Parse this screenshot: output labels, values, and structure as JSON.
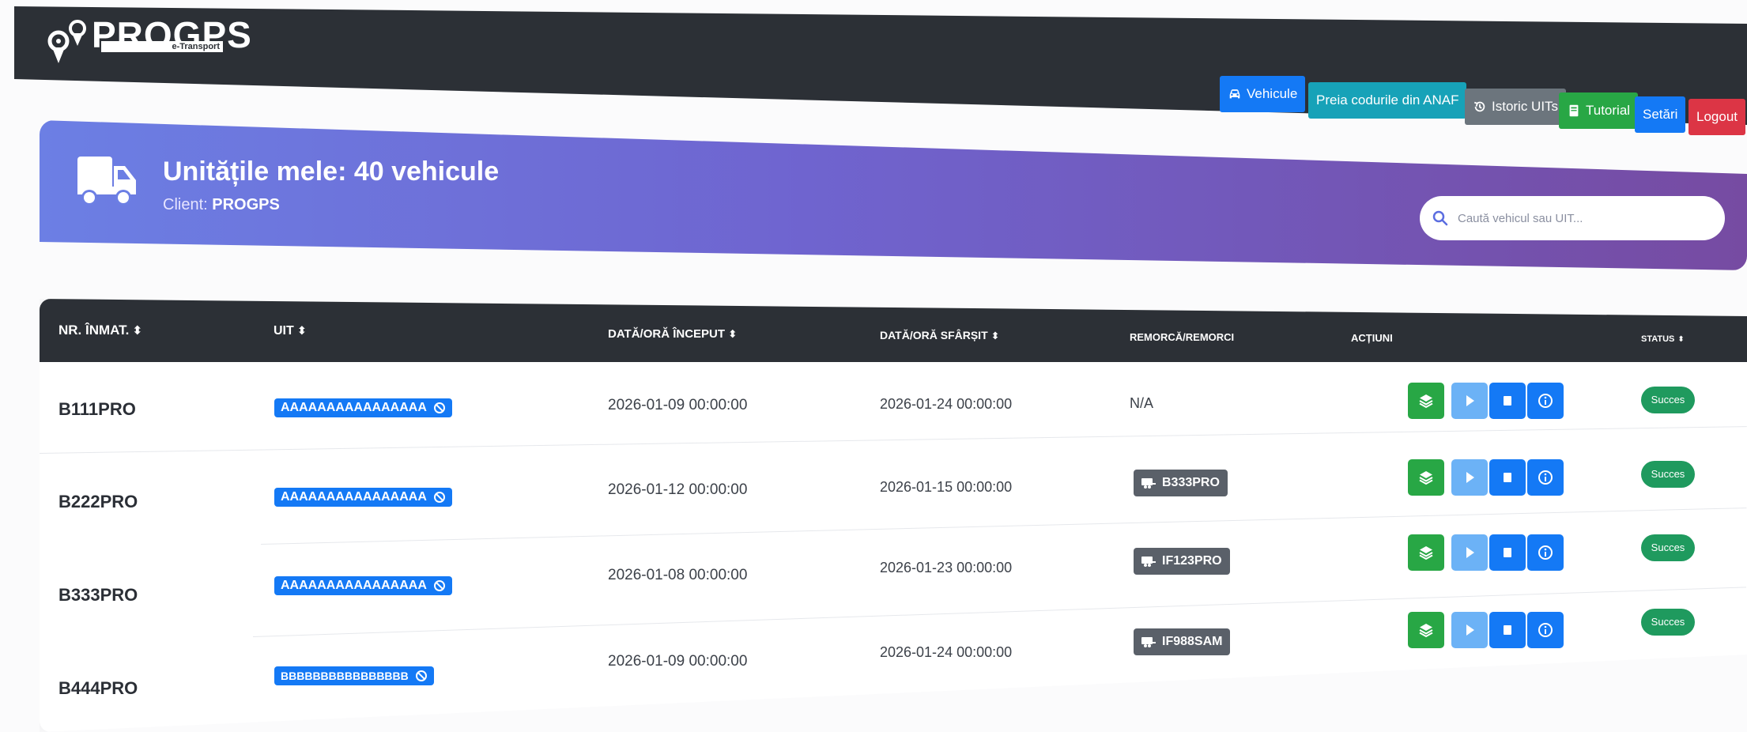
{
  "brand": {
    "name": "PROGPS",
    "tagline": "e-Transport"
  },
  "nav": {
    "vehicles": "Vehicule",
    "fetch_anaf": "Preia codurile din ANAF",
    "uit_history": "Istoric UITs",
    "tutorial": "Tutorial",
    "settings": "Setări",
    "logout": "Logout"
  },
  "banner": {
    "title": "Unitățile mele: 40 vehicule",
    "client_label": "Client:",
    "client_name": "PROGPS"
  },
  "search": {
    "placeholder": "Caută vehicul sau UIT..."
  },
  "table": {
    "headers": {
      "plate": "NR. ÎNMAT.",
      "uit": "UIT",
      "start": "DATĂ/ORĂ ÎNCEPUT",
      "end": "DATĂ/ORĂ SFÂRȘIT",
      "trailer": "REMORCĂ/REMORCI",
      "actions": "ACȚIUNI",
      "status": "STATUS"
    },
    "sort_glyph": "⬍",
    "rows": [
      {
        "plate": "B111PRO",
        "uit": "AAAAAAAAAAAAAAAA",
        "start": "2026-01-09 00:00:00",
        "end": "2026-01-24 00:00:00",
        "trailer": "N/A",
        "status": "Succes"
      },
      {
        "plate": "B222PRO",
        "uit": "AAAAAAAAAAAAAAAA",
        "start": "2026-01-12 00:00:00",
        "end": "2026-01-15 00:00:00",
        "trailer": "B333PRO",
        "status": "Succes"
      },
      {
        "plate": "B333PRO",
        "uit": "AAAAAAAAAAAAAAAA",
        "start": "2026-01-08 00:00:00",
        "end": "2026-01-23 00:00:00",
        "trailer": "IF123PRO",
        "status": "Succes"
      },
      {
        "plate": "B444PRO",
        "uit": "BBBBBBBBBBBBBBBB",
        "start": "2026-01-09 00:00:00",
        "end": "2026-01-24 00:00:00",
        "trailer": "IF988SAM",
        "status": "Succes"
      }
    ]
  },
  "colors": {
    "dark": "#2c3036",
    "primary": "#1479f5",
    "info": "#17a2b8",
    "secondary": "#6c757d",
    "success": "#28a745",
    "danger": "#dc3545",
    "play": "#6cb2f6",
    "status": "#1f9a5e"
  },
  "icons": {
    "vehicles": "car-icon",
    "uit_history": "history-icon",
    "tutorial": "book-icon",
    "search": "search-icon",
    "banner": "truck-icon",
    "uit_badge": "ban-icon",
    "trailer": "trailer-icon",
    "actions": [
      "layers-icon",
      "play-icon",
      "stop-icon",
      "info-icon"
    ]
  }
}
